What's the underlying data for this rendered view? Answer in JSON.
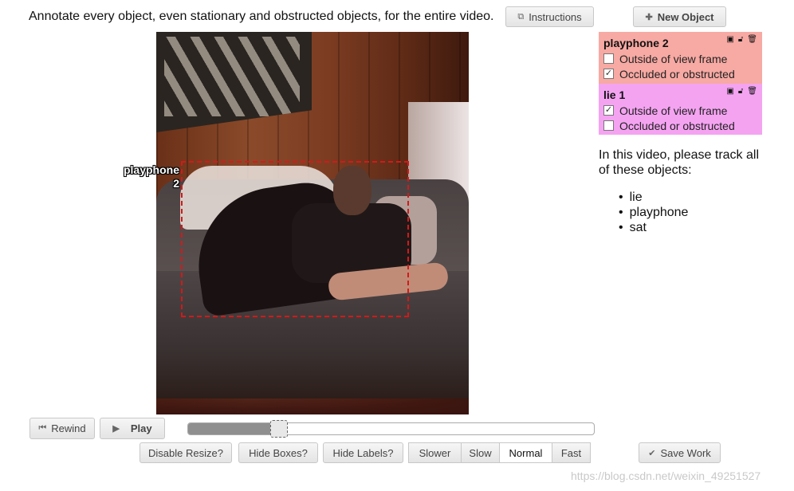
{
  "header": {
    "instruction": "Annotate every object, even stationary and obstructed objects, for the entire video.",
    "instructions_button": "Instructions",
    "new_object_button": "New Object"
  },
  "video": {
    "box_label_line1": "playphone",
    "box_label_line2": "2"
  },
  "objects": [
    {
      "title": "playphone 2",
      "color": "#f7a9a3",
      "outside_label": "Outside of view frame",
      "outside_checked": false,
      "occluded_label": "Occluded or obstructed",
      "occluded_checked": true
    },
    {
      "title": "lie 1",
      "color": "#f4a3f1",
      "outside_label": "Outside of view frame",
      "outside_checked": true,
      "occluded_label": "Occluded or obstructed",
      "occluded_checked": false
    }
  ],
  "tracking": {
    "text": "In this video, please track all of these objects:",
    "items": [
      "lie",
      "playphone",
      "sat"
    ]
  },
  "playback": {
    "rewind": "Rewind",
    "play": "Play",
    "progress": 0.2
  },
  "options": {
    "disable_resize": "Disable Resize?",
    "hide_boxes": "Hide Boxes?",
    "hide_labels": "Hide Labels?",
    "speeds": [
      "Slower",
      "Slow",
      "Normal",
      "Fast"
    ],
    "active_speed": "Normal",
    "save": "Save Work"
  },
  "watermark": "https://blog.csdn.net/weixin_49251527"
}
